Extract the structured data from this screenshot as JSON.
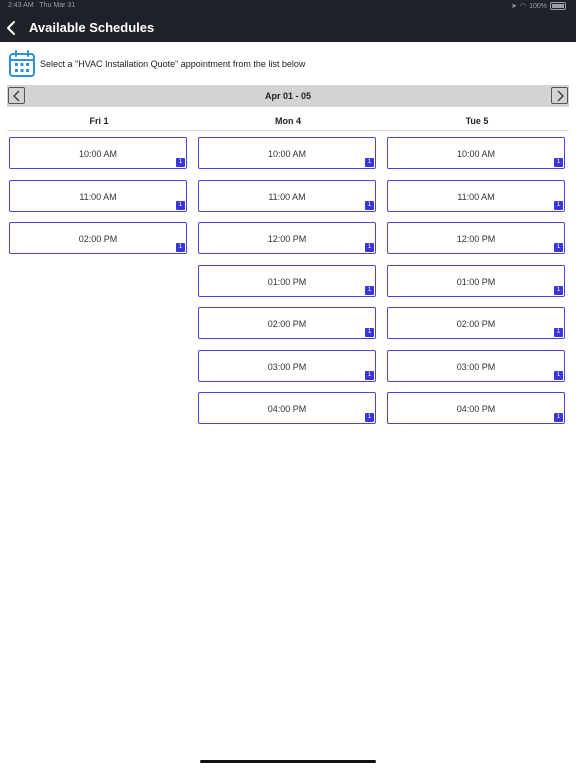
{
  "status_bar": {
    "time": "2:43 AM",
    "date": "Thu Mar 31",
    "battery": "100%"
  },
  "header": {
    "title": "Available Schedules",
    "back_icon": "chevron-left-icon"
  },
  "intro": {
    "icon": "calendar-icon",
    "text": "Select a \"HVAC Installation Quote\" appointment from the list below"
  },
  "week": {
    "label": "Apr 01 - 05",
    "prev_icon": "chevron-left-icon",
    "next_icon": "chevron-right-icon"
  },
  "days": [
    {
      "name": "Fri 1",
      "slots": [
        {
          "time": "10:00 AM",
          "count": "1"
        },
        {
          "time": "11:00 AM",
          "count": "1"
        },
        {
          "time": "02:00 PM",
          "count": "1"
        }
      ]
    },
    {
      "name": "Mon 4",
      "slots": [
        {
          "time": "10:00 AM",
          "count": "1"
        },
        {
          "time": "11:00 AM",
          "count": "1"
        },
        {
          "time": "12:00 PM",
          "count": "1"
        },
        {
          "time": "01:00 PM",
          "count": "1"
        },
        {
          "time": "02:00 PM",
          "count": "1"
        },
        {
          "time": "03:00 PM",
          "count": "1"
        },
        {
          "time": "04:00 PM",
          "count": "1"
        }
      ]
    },
    {
      "name": "Tue 5",
      "slots": [
        {
          "time": "10:00 AM",
          "count": "1"
        },
        {
          "time": "11:00 AM",
          "count": "1"
        },
        {
          "time": "12:00 PM",
          "count": "1"
        },
        {
          "time": "01:00 PM",
          "count": "1"
        },
        {
          "time": "02:00 PM",
          "count": "1"
        },
        {
          "time": "03:00 PM",
          "count": "1"
        },
        {
          "time": "04:00 PM",
          "count": "1"
        }
      ]
    }
  ],
  "colors": {
    "header_bg": "#1f2228",
    "accent": "#3b36d9",
    "slot_border": "#4b45d6",
    "week_bar_bg": "#d3d3d3",
    "calendar_icon": "#2f8fd8"
  }
}
